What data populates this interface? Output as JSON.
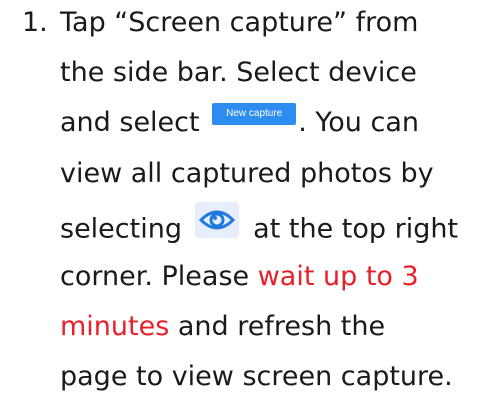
{
  "step": {
    "number": "1.",
    "line1": "Tap “Screen capture” from",
    "line2": "the side bar. Select device",
    "line3_before": "and select",
    "button_label": "New capture",
    "line3_after": ". You can",
    "line4": "view all captured photos by",
    "line5_before": "selecting",
    "line5_after": "at the top right",
    "line6_before": "corner. Please ",
    "line6_red": "wait up to 3",
    "line7_red": "minutes",
    "line7_after": " and refresh the",
    "line8": "page to view screen capture."
  },
  "icons": {
    "eye": "eye-icon"
  },
  "colors": {
    "highlight": "#e8202a",
    "button": "#2d8cf0",
    "icon": "#1f7ae0"
  }
}
